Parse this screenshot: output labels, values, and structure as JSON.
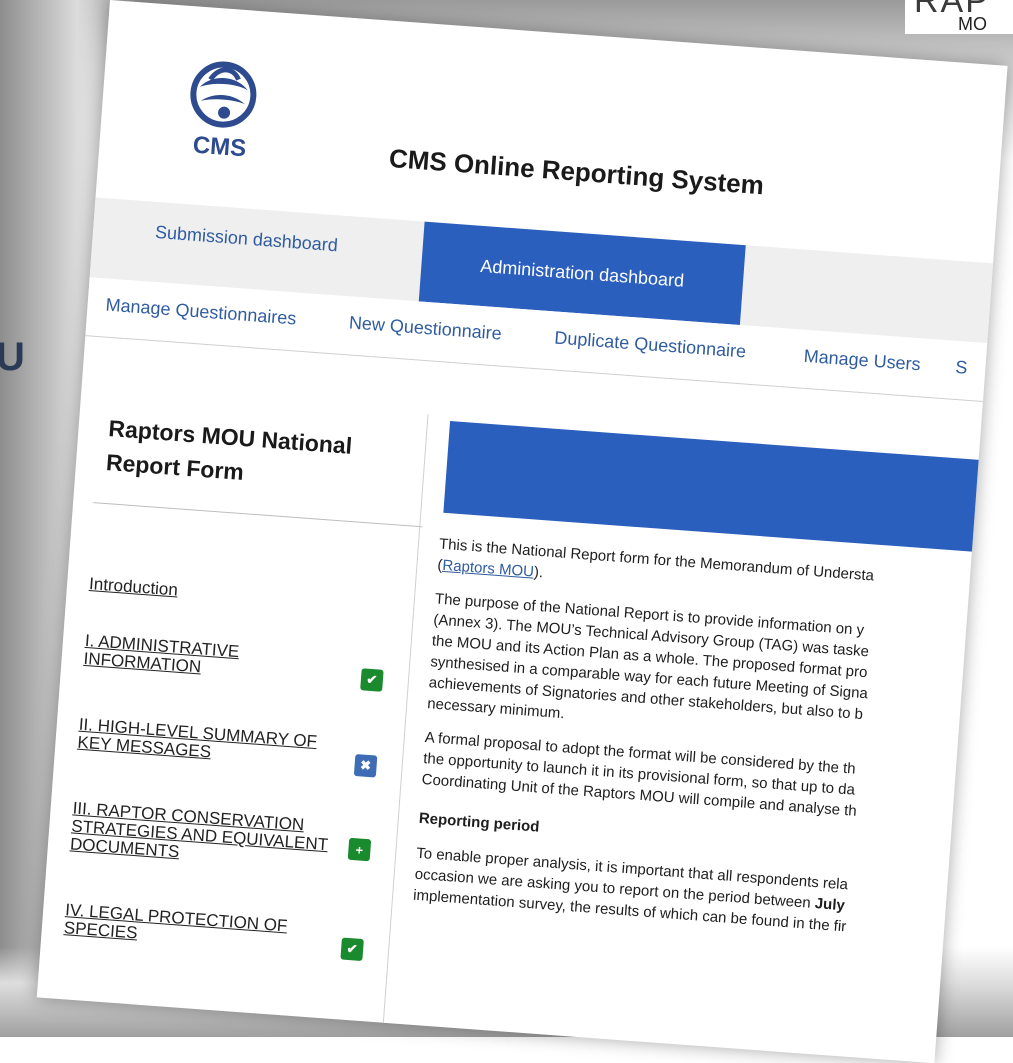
{
  "background": {
    "top_right_big": "RAP",
    "top_right_small": "MO",
    "left_big": "U"
  },
  "header": {
    "logo_text": "CMS",
    "title": "CMS Online Reporting System"
  },
  "tabs": [
    {
      "label": "Submission dashboard",
      "active": false
    },
    {
      "label": "Administration dashboard",
      "active": true
    }
  ],
  "subnav": [
    "Manage Questionnaires",
    "New Questionnaire",
    "Duplicate Questionnaire",
    "Manage Users",
    "S"
  ],
  "sidebar": {
    "title": "Raptors MOU National Report Form",
    "items": [
      {
        "label": "Introduction",
        "status": "none"
      },
      {
        "label": "I. ADMINISTRATIVE INFORMATION",
        "status": "complete"
      },
      {
        "label": "II. HIGH-LEVEL SUMMARY OF KEY MESSAGES",
        "status": "incomplete"
      },
      {
        "label": "III. RAPTOR CONSERVATION STRATEGIES AND EQUIVALENT DOCUMENTS",
        "status": "add"
      },
      {
        "label": "IV. LEGAL PROTECTION OF SPECIES",
        "status": "complete"
      }
    ]
  },
  "content": {
    "p1_line1": "This is the National Report form for the Memorandum of Understa",
    "p1_link": "Raptors MOU",
    "p2_lines": [
      "The purpose of the National Report is to provide information on y",
      "(Annex 3). The MOU’s Technical Advisory Group (TAG) was taske",
      "the MOU and its Action Plan as a whole. The proposed format pro",
      "synthesised in a comparable way for each future Meeting of Signa",
      "achievements of Signatories and other stakeholders, but also to b",
      "necessary minimum."
    ],
    "p3_lines": [
      "A formal proposal to adopt the format will be considered by the th",
      "the opportunity to launch it in its provisional form, so that up to da",
      "Coordinating Unit of the Raptors MOU will compile and analyse th"
    ],
    "section_heading": "Reporting period",
    "p4_line1": "To enable proper analysis, it is important that all respondents rela",
    "p4_line2_pre": "occasion we are asking you to report on the period between ",
    "p4_line2_bold": "July",
    "p4_line3": "implementation survey, the results of which can be found in the fir"
  },
  "colors": {
    "accent": "#2b5fbd",
    "link": "#2f5ca0",
    "status_complete": "#1a8a2e",
    "status_incomplete": "#3e6db5"
  }
}
